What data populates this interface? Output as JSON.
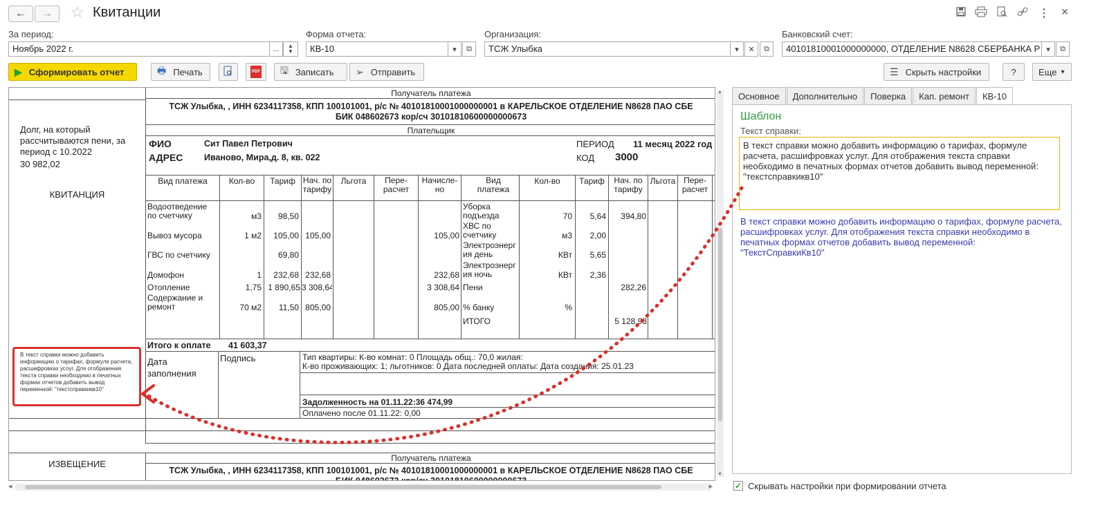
{
  "window": {
    "title": "Квитанции",
    "nav_back": "←",
    "nav_fwd": "→",
    "star": "☆"
  },
  "toolbar_icons": [
    "save-icon",
    "print-icon",
    "preview-icon",
    "link-icon",
    "more-vertical-icon",
    "close-icon"
  ],
  "filters": {
    "period_label": "За период:",
    "period_value": "Ноябрь 2022 г.",
    "form_label": "Форма отчета:",
    "form_value": "КВ-10",
    "org_label": "Организация:",
    "org_value": "ТСЖ Улыбка",
    "bank_label": "Банковский счет:",
    "bank_value": "40101810001000000000, ОТДЕЛЕНИЕ N8628 СБЕРБАНКА Р"
  },
  "actions": {
    "generate": "Сформировать отчет",
    "print": "Печать",
    "write": "Записать",
    "send": "Отправить",
    "hide_settings": "Скрыть настройки",
    "help": "?",
    "more": "Еще"
  },
  "report": {
    "recipient_header": "Получатель платежа",
    "recipient_line1": "ТСЖ Улыбка, , ИНН 6234117358, КПП 100101001, р/с № 40101810001000000001 в КАРЕЛЬСКОЕ ОТДЕЛЕНИЕ N8628 ПАО СБЕ",
    "recipient_line2": "БИК 048602673 кор/сч 30101810600000000673",
    "payer_header": "Плательщик",
    "debt_text": "Долг, на который рассчитываются пени, за период с 10.2022",
    "debt_value": "30 982,02",
    "receipt_label": "КВИТАНЦИЯ",
    "fio_label": "ФИО",
    "fio_value": "Сит Павел Петрович",
    "address_label": "АДРЕС",
    "address_value": "Иваново, Мира,д. 8, кв. 022",
    "period_label": "ПЕРИОД",
    "period_value": "11 месяц 2022 год",
    "code_label": "КОД",
    "code_value": "3000",
    "columns_left": [
      "Вид платежа",
      "Кол-во",
      "Тариф",
      "Нач. по тарифу",
      "Льгота",
      "Пере-расчет",
      "Начисле-но"
    ],
    "columns_right": [
      "Вид платежа",
      "Кол-во",
      "Тариф",
      "Нач. по тарифу",
      "Льгота",
      "Пере-расчет"
    ],
    "rows_left": [
      {
        "name": "Водоотведение по счетчику",
        "qty": "м3",
        "tariff": "98,50",
        "accr": "",
        "total": ""
      },
      {
        "name": "Вывоз мусора",
        "qty": "1 м2",
        "tariff": "105,00",
        "accr": "105,00",
        "total": "105,00"
      },
      {
        "name": "ГВС по счетчику",
        "qty": "",
        "tariff": "69,80",
        "accr": "",
        "total": ""
      },
      {
        "name": "Домофон",
        "qty": "1",
        "tariff": "232,68",
        "accr": "232,68",
        "total": "232,68"
      },
      {
        "name": "Отопление",
        "qty": "1,75",
        "tariff": "1 890,65",
        "accr": "3 308,64",
        "total": "3 308,64"
      },
      {
        "name": "Содержание и ремонт",
        "qty": "70 м2",
        "tariff": "11,50",
        "accr": "805,00",
        "total": "805,00"
      }
    ],
    "rows_right": [
      {
        "name": "Уборка подъезда",
        "qty": "70",
        "tariff": "5,64",
        "accr": "394,80"
      },
      {
        "name": "ХВС по счетчику",
        "qty": "м3",
        "tariff": "2,00",
        "accr": ""
      },
      {
        "name": "Электроэнергия день",
        "qty": "КВт",
        "tariff": "5,65",
        "accr": ""
      },
      {
        "name": "Электроэнергия ночь",
        "qty": "КВт",
        "tariff": "2,36",
        "accr": ""
      },
      {
        "name": "Пени",
        "qty": "",
        "tariff": "",
        "accr": "282,26"
      },
      {
        "name": "% банку",
        "qty": "%",
        "tariff": "",
        "accr": ""
      },
      {
        "name": "ИТОГО",
        "qty": "",
        "tariff": "",
        "accr": "5 128,98"
      }
    ],
    "total_label": "Итого к оплате",
    "total_value": "41 603,37",
    "date_label": "Дата заполнения",
    "signature_label": "Подпись",
    "flat_info1": "Тип квартиры:  К-во комнат: 0 Площадь общ.: 70,0 жилая:",
    "flat_info2": "К-во проживающих: 1; льготников: 0 Дата последней оплаты:  Дата создания: 25.01.23",
    "debt_summary": "Задолженность на 01.11.22:36 474,99",
    "paid_after": "Оплачено после 01.11.22: 0,00",
    "notice_label": "ИЗВЕЩЕНИЕ",
    "annotation_text": "В текст справки можно добавить информацию о тарифах, формуле расчета, расшифровках услуг. Для отображения текста справки необходимо в печатных формах отчетов добавить вывод переменной: \"текстсправкикв10\""
  },
  "panel": {
    "tabs": [
      "Основное",
      "Дополнительно",
      "Поверка",
      "Кап. ремонт",
      "КВ-10"
    ],
    "active_tab": "КВ-10",
    "section_title": "Шаблон",
    "help_label": "Текст справки:",
    "help_text": "В текст справки можно добавить информацию о тарифах, формуле расчета, расшифровках услуг. Для отображения текста справки необходимо в печатных формах отчетов добавить вывод переменной: \"текстсправкикв10\"",
    "hint_text": "В текст справки можно добавить информацию о тарифах, формуле расчета, расшифровках услуг. Для отображения текста справки необходимо в печатных формах отчетов добавить вывод переменной: \"ТекстСправкиКв10\"",
    "checkbox_label": "Скрывать настройки при формировании отчета",
    "checkbox_checked": true
  },
  "colors": {
    "accent_yellow": "#f5d800",
    "section_green": "#2c9e3a",
    "hint_blue": "#3a3ab0",
    "annotation_red": "#d9302c"
  }
}
